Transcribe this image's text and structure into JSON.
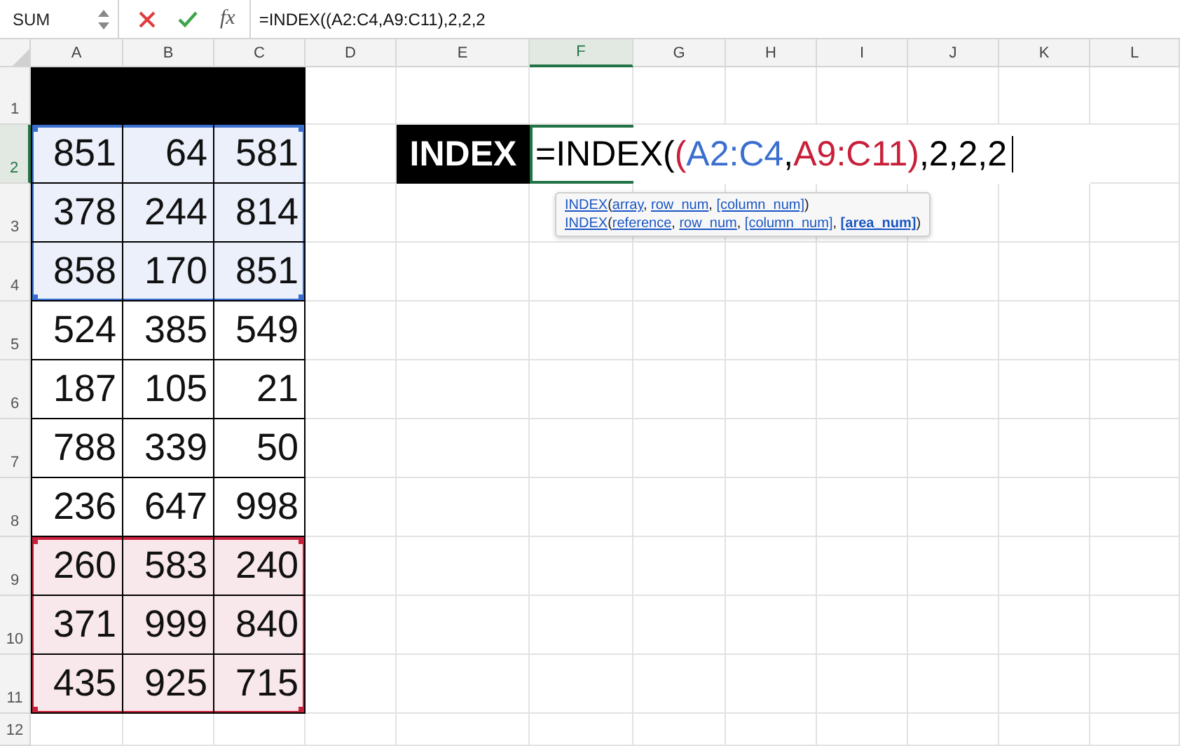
{
  "formula_bar": {
    "name_box": "SUM",
    "fx": "fx",
    "formula": "=INDEX((A2:C4,A9:C11),2,2,2"
  },
  "columns": [
    {
      "label": "A",
      "selected": false
    },
    {
      "label": "B",
      "selected": false
    },
    {
      "label": "C",
      "selected": false
    },
    {
      "label": "D",
      "selected": false
    },
    {
      "label": "E",
      "selected": false
    },
    {
      "label": "F",
      "selected": true
    },
    {
      "label": "G",
      "selected": false
    },
    {
      "label": "H",
      "selected": false
    },
    {
      "label": "I",
      "selected": false
    },
    {
      "label": "J",
      "selected": false
    },
    {
      "label": "K",
      "selected": false
    },
    {
      "label": "L",
      "selected": false
    }
  ],
  "rows": [
    {
      "label": "1",
      "selected": false,
      "header_band": true,
      "cells": []
    },
    {
      "label": "2",
      "selected": true,
      "color": "#3a6fd0",
      "cells": [
        "851",
        "64",
        "581"
      ]
    },
    {
      "label": "3",
      "selected": false,
      "color": "#3a6fd0",
      "cells": [
        "378",
        "244",
        "814"
      ]
    },
    {
      "label": "4",
      "selected": false,
      "color": "#3a6fd0",
      "cells": [
        "858",
        "170",
        "851"
      ]
    },
    {
      "label": "5",
      "selected": false,
      "cells": [
        "524",
        "385",
        "549"
      ]
    },
    {
      "label": "6",
      "selected": false,
      "cells": [
        "187",
        "105",
        "21"
      ]
    },
    {
      "label": "7",
      "selected": false,
      "cells": [
        "788",
        "339",
        "50"
      ]
    },
    {
      "label": "8",
      "selected": false,
      "cells": [
        "236",
        "647",
        "998"
      ]
    },
    {
      "label": "9",
      "selected": false,
      "color": "#c8203a",
      "cells": [
        "260",
        "583",
        "240"
      ]
    },
    {
      "label": "10",
      "selected": false,
      "color": "#c8203a",
      "cells": [
        "371",
        "999",
        "840"
      ]
    },
    {
      "label": "11",
      "selected": false,
      "color": "#c8203a",
      "cells": [
        "435",
        "925",
        "715"
      ]
    },
    {
      "label": "12",
      "selected": false,
      "cells": []
    }
  ],
  "label_cell": {
    "text": "INDEX"
  },
  "editor": {
    "segments": [
      {
        "text": "=INDEX(",
        "color": "#000000"
      },
      {
        "text": "(",
        "color": "#c8203a"
      },
      {
        "text": "A2:C4",
        "color": "#3a6fd0"
      },
      {
        "text": ",",
        "color": "#000000"
      },
      {
        "text": "A9:C11",
        "color": "#c8203a"
      },
      {
        "text": ")",
        "color": "#c8203a"
      },
      {
        "text": ",2,2,2",
        "color": "#000000"
      }
    ]
  },
  "tooltip": {
    "lines": [
      [
        {
          "text": "INDEX",
          "kind": "link"
        },
        {
          "text": "(",
          "kind": "plain"
        },
        {
          "text": "array",
          "kind": "link"
        },
        {
          "text": ", ",
          "kind": "plain"
        },
        {
          "text": "row_num",
          "kind": "link"
        },
        {
          "text": ", ",
          "kind": "plain"
        },
        {
          "text": "[column_num]",
          "kind": "link"
        },
        {
          "text": ")",
          "kind": "plain"
        }
      ],
      [
        {
          "text": "INDEX",
          "kind": "link"
        },
        {
          "text": "(",
          "kind": "plain"
        },
        {
          "text": "reference",
          "kind": "link"
        },
        {
          "text": ", ",
          "kind": "plain"
        },
        {
          "text": "row_num",
          "kind": "link"
        },
        {
          "text": ", ",
          "kind": "plain"
        },
        {
          "text": "[column_num]",
          "kind": "link"
        },
        {
          "text": ", ",
          "kind": "plain"
        },
        {
          "text": "[area_num]",
          "kind": "bold_link"
        },
        {
          "text": ")",
          "kind": "plain"
        }
      ]
    ]
  }
}
